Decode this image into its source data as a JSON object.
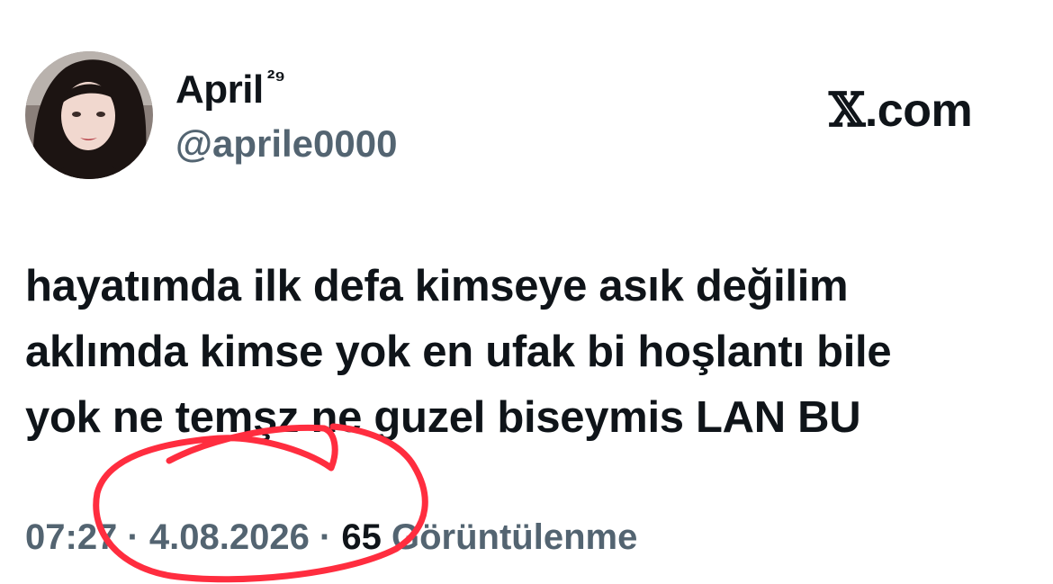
{
  "author": {
    "display_name": "April",
    "superscript": "²⁹",
    "handle": "@aprile0000"
  },
  "brand": {
    "logo": "𝕏",
    "domain": ".com"
  },
  "tweet": {
    "lines": [
      "hayatımda ilk defa kimseye asık değilim",
      "aklımda kimse yok en ufak bi hoşlantı bile",
      "yok ne temşz ne guzel biseymis LAN BU"
    ]
  },
  "meta": {
    "time": "07:27",
    "sep1": " · ",
    "date": "4.08.2026",
    "sep2": " · ",
    "views": "65",
    "views_label": " Görüntülenme"
  },
  "annotation": {
    "color": "#ff2d3f"
  },
  "colors": {
    "text": "#0f1419",
    "secondary": "#536471",
    "background": "#ffffff"
  }
}
